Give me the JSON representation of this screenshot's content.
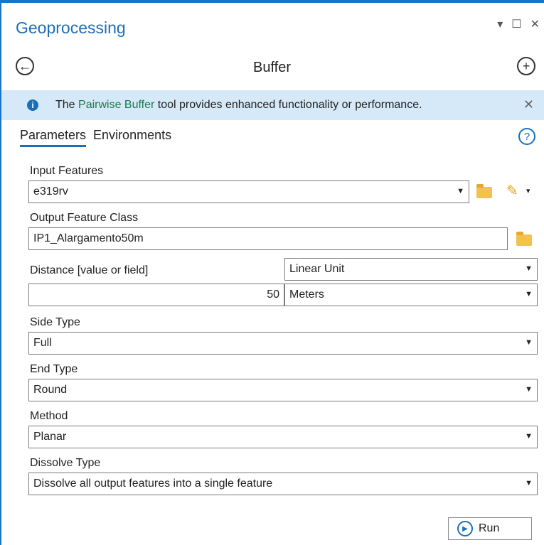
{
  "panel": {
    "title": "Geoprocessing",
    "controls": {
      "pin": "▾",
      "maximize": "☐",
      "close": "✕"
    }
  },
  "tool": {
    "name": "Buffer",
    "back_icon": "←",
    "add_icon": "+"
  },
  "banner": {
    "prefix": "The ",
    "link": "Pairwise Buffer",
    "suffix": " tool provides enhanced functionality or performance.",
    "close": "✕"
  },
  "tabs": [
    {
      "label": "Parameters",
      "active": true
    },
    {
      "label": "Environments",
      "active": false
    }
  ],
  "help_icon": "?",
  "params": {
    "input_features": {
      "label": "Input Features",
      "value": "e319rv"
    },
    "output_feature_class": {
      "label": "Output Feature Class",
      "value": "IP1_Alargamento50m"
    },
    "distance": {
      "label": "Distance [value or field]",
      "mode": "Linear Unit",
      "value": "50",
      "unit": "Meters"
    },
    "side_type": {
      "label": "Side Type",
      "value": "Full"
    },
    "end_type": {
      "label": "End Type",
      "value": "Round"
    },
    "method": {
      "label": "Method",
      "value": "Planar"
    },
    "dissolve_type": {
      "label": "Dissolve Type",
      "value": "Dissolve all output features into a single feature"
    }
  },
  "run_button": {
    "label": "Run"
  },
  "colors": {
    "accent": "#1b6fb8",
    "banner_bg": "#d6e9f8",
    "link": "#1b7a4a",
    "folder": "#f2c14e"
  }
}
